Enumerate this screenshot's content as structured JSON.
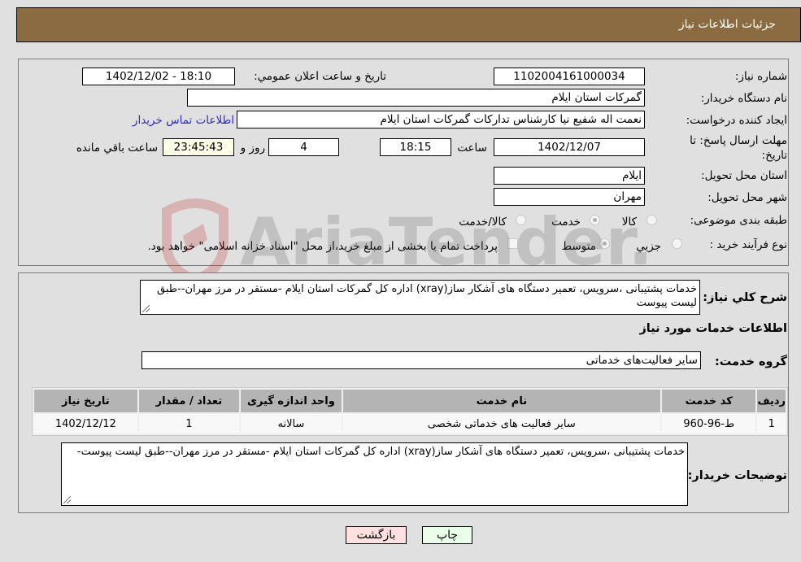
{
  "header": {
    "title": "جزئیات اطلاعات نیاز"
  },
  "form": {
    "need_number": {
      "label": "شماره نیاز:",
      "value": "1102004161000034"
    },
    "announce_datetime": {
      "label": "تاریخ و ساعت اعلان عمومي:",
      "value": "1402/12/02 - 18:10"
    },
    "buyer_org": {
      "label": "نام دستگاه خريدار:",
      "value": "گمرکات استان ایلام"
    },
    "creator": {
      "label": "ایجاد کننده درخواست:",
      "value": "نعمت اله شفیع نیا کارشناس تدارکات گمرکات استان ایلام"
    },
    "buyer_contact_link": "اطلاعات تماس خريدار",
    "deadline": {
      "label": "مهلت ارسال پاسخ: تا تاریخ:",
      "date": "1402/12/07",
      "time_label": "ساعت",
      "time": "18:15",
      "days": "4",
      "days_label": "روز و",
      "remaining": "23:45:43",
      "remaining_label": "ساعت باقي مانده"
    },
    "province": {
      "label": "استان محل تحویل:",
      "value": "ایلام"
    },
    "city": {
      "label": "شهر محل تحویل:",
      "value": "مهران"
    },
    "category": {
      "label": "طبقه بندی موضوعی:",
      "options": [
        "کالا",
        "خدمت",
        "کالا/خدمت"
      ],
      "selected": "خدمت"
    },
    "purchase_type": {
      "label": "نوع فرآیند خرید :",
      "options": [
        "جزيي",
        "متوسط"
      ],
      "selected": "متوسط",
      "treasury_checkbox_label": "پرداخت تمام یا بخشی از مبلغ خرید،از محل \"اسناد خزانه اسلامی\" خواهد بود.",
      "treasury_checked": false
    }
  },
  "description": {
    "label": "شرح کلي نياز:",
    "value": "خدمات پشتیبانی ،سرویس، تعمیر دستگاه های آشکار ساز(xray) اداره کل گمرکات استان ایلام -مستقر در مرز مهران--طبق لیست پیوست"
  },
  "services_section": {
    "title": "اطلاعات خدمات مورد نياز",
    "group_label": "گروه خدمت:",
    "group_value": "سایر فعالیت‌های خدماتی",
    "table": {
      "headers": [
        "رديف",
        "کد خدمت",
        "نام خدمت",
        "واحد اندازه گيری",
        "تعداد / مقدار",
        "تاريخ نياز"
      ],
      "rows": [
        [
          "1",
          "ط-96-960",
          "سایر فعالیت های خدماتی شخصی",
          "سالانه",
          "1",
          "1402/12/12"
        ]
      ]
    },
    "buyer_notes_label": "توضيحات خريدار:",
    "buyer_notes": "خدمات پشتیبانی ،سرویس، تعمیر دستگاه های آشکار ساز(xray) اداره کل گمرکات استان ایلام -مستقر در مرز مهران--طبق لیست پیوست-"
  },
  "buttons": {
    "print": "چاپ",
    "back": "بازگشت"
  },
  "watermark": {
    "text": "AriaTender.neT"
  }
}
